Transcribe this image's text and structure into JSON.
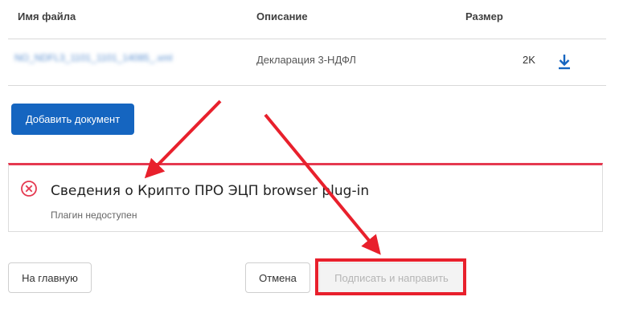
{
  "table": {
    "headers": [
      "Имя файла",
      "Описание",
      "Размер"
    ],
    "rows": [
      {
        "filename": "NO_NDFL3_1101_1101_14085_.xml",
        "description": "Декларация 3-НДФЛ",
        "size": "2K"
      }
    ]
  },
  "add_document_label": "Добавить документ",
  "alert": {
    "title": "Сведения о Крипто ПРО ЭЦП browser plug-in",
    "message": "Плагин недоступен",
    "color": "#e53950"
  },
  "footer": {
    "home_label": "На главную",
    "cancel_label": "Отмена",
    "sign_send_label": "Подписать и направить"
  },
  "colors": {
    "primary": "#1565c0",
    "annotation": "#e8202c"
  },
  "icons": {
    "download": "download-icon",
    "error": "error-circle-icon"
  }
}
